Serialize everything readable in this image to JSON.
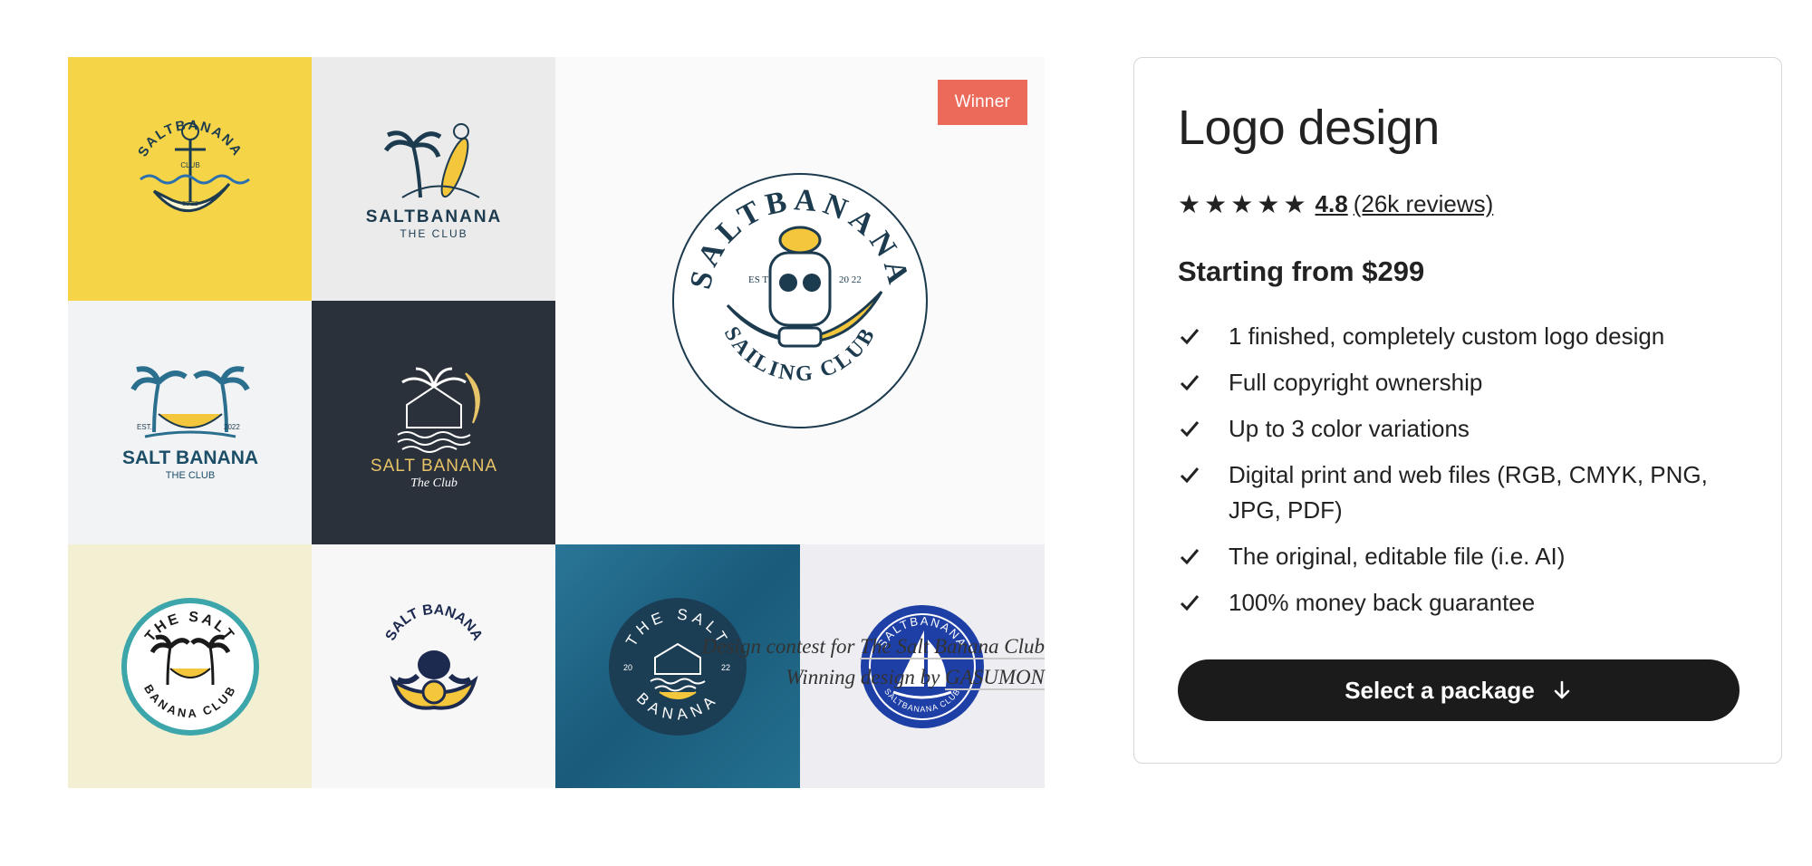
{
  "gallery": {
    "winner_badge": "Winner",
    "tiles": [
      {
        "bg": "#f5d547",
        "text": "SALTBANANA",
        "sub": "CLUB",
        "est": "20 22"
      },
      {
        "bg": "#ebebeb",
        "text": "SALTBANANA",
        "sub": "THE CLUB"
      },
      {
        "bg": "#f2f3f5",
        "text": "SALT BANANA",
        "sub": "THE CLUB",
        "est_left": "EST.",
        "est_right": "2022"
      },
      {
        "bg": "#2b313b",
        "text": "SALT BANANA",
        "sub": "The Club"
      },
      {
        "bg": "#f3efd2",
        "text_top": "THE SALT",
        "text_bottom": "BANANA CLUB"
      },
      {
        "bg": "#f7f7f7",
        "text": "SALT BANANA"
      },
      {
        "bg": "#1e5f7e",
        "text_top": "THE SALT",
        "text_bottom": "BANANA",
        "est_left": "20",
        "est_right": "22"
      },
      {
        "bg": "#ededf2",
        "text_top": "SALTBANANA",
        "text_bottom": "SALTBANANA CLUB"
      }
    ],
    "winner_logo": {
      "text_top": "SALTBANANA",
      "text_bottom": "SAILING CLUB",
      "est_left": "ES TD",
      "est_right": "20 22"
    }
  },
  "caption": {
    "line1_prefix": "Design contest for",
    "line1_link": "The Salt Banana Club",
    "line2_prefix": "Winning design by",
    "line2_link": "GASUMON"
  },
  "card": {
    "title": "Logo design",
    "rating": "4.8",
    "reviews": "(26k reviews)",
    "stars": 5,
    "price": "Starting from $299",
    "features": [
      "1 finished, completely custom logo design",
      "Full copyright ownership",
      "Up to 3 color variations",
      "Digital print and web files (RGB, CMYK, PNG, JPG, PDF)",
      "The original, editable file (i.e. AI)",
      "100% money back guarantee"
    ],
    "cta_label": "Select a package"
  },
  "colors": {
    "accent_badge": "#ec6a5a",
    "cta_bg": "#1b1b1b",
    "navy": "#1d3b4f",
    "banana": "#f3c63c"
  }
}
